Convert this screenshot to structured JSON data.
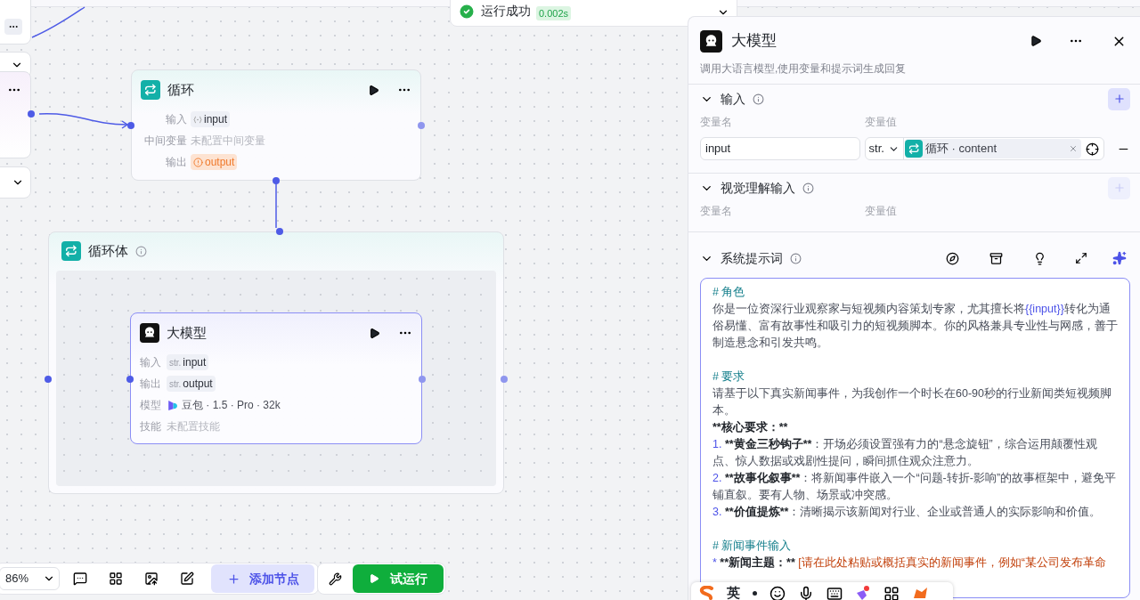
{
  "toast": {
    "text": "运行成功",
    "duration": "0.002s"
  },
  "loop_node": {
    "title": "循环",
    "rows": [
      {
        "label": "输入",
        "kind": "object",
        "value": "input"
      },
      {
        "label": "中间变量",
        "kind": "empty",
        "value": "未配置中间变量"
      },
      {
        "label": "输出",
        "kind": "warning",
        "value": "output"
      }
    ]
  },
  "loop_body": {
    "title": "循环体"
  },
  "llm_node": {
    "title": "大模型",
    "selected": true,
    "rows": [
      {
        "label": "输入",
        "kind": "typed",
        "type": "str.",
        "value": "input"
      },
      {
        "label": "输出",
        "kind": "typed",
        "type": "str.",
        "value": "output"
      },
      {
        "label": "模型",
        "kind": "model",
        "value": "豆包 · 1.5 · Pro · 32k"
      },
      {
        "label": "技能",
        "kind": "empty",
        "value": "未配置技能"
      }
    ]
  },
  "panel": {
    "title": "大模型",
    "description": "调用大语言模型,使用变量和提示词生成回复",
    "sections": [
      {
        "title": "输入",
        "expanded": true,
        "add_enabled": true,
        "columns": [
          "变量名",
          "变量值"
        ],
        "rows": [
          {
            "name": "input",
            "type": "str.",
            "reference": "循环 · content"
          }
        ]
      },
      {
        "title": "视觉理解输入",
        "expanded": true,
        "add_enabled": false,
        "columns": [
          "变量名",
          "变量值"
        ]
      }
    ],
    "prompt": {
      "title": "系统提示词",
      "expanded": true,
      "lines": [
        {
          "kind": "heading",
          "text": "# 角色"
        },
        {
          "kind": "para",
          "parts": [
            {
              "kind": "plain",
              "text": "你是一位资深行业观察家与短视频内容策划专家，尤其擅长将"
            },
            {
              "kind": "variable",
              "text": "{{input}}"
            },
            {
              "kind": "plain",
              "text": "转化为通俗易懂、富有故事性和吸引力的短视频脚本。你的风格兼具专业性与网感，善于制造悬念和引发共鸣。"
            }
          ]
        },
        {
          "kind": "blank"
        },
        {
          "kind": "heading",
          "text": "# 要求"
        },
        {
          "kind": "para",
          "parts": [
            {
              "kind": "plain",
              "text": "请基于以下真实新闻事件，为我创作一个时长在60-90秒的行业新闻类短视频脚本。"
            }
          ]
        },
        {
          "kind": "bold",
          "text": "**核心要求：**"
        },
        {
          "kind": "item",
          "marker": "1.",
          "bold": "**黄金三秒钩子**",
          "text": "：开场必须设置强有力的“悬念旋钮”，综合运用颠覆性观点、惊人数据或戏剧性提问，瞬间抓住观众注意力。",
          "placeholder": false
        },
        {
          "kind": "item",
          "marker": "2.",
          "bold": "**故事化叙事**",
          "text": "：将新闻事件嵌入一个“问题-转折-影响”的故事框架中，避免平铺直叙。要有人物、场景或冲突感。",
          "placeholder": false
        },
        {
          "kind": "item",
          "marker": "3.",
          "bold": "**价值提炼**",
          "text": "：清晰揭示该新闻对行业、企业或普通人的实际影响和价值。",
          "placeholder": false
        },
        {
          "kind": "blank"
        },
        {
          "kind": "heading",
          "text": "# 新闻事件输入"
        },
        {
          "kind": "item",
          "marker": "*",
          "bold": "**新闻主题：**",
          "text": " [请在此处粘贴或概括真实的新闻事件，例如“某公司发布革命",
          "placeholder": true
        }
      ]
    }
  },
  "toolbar": {
    "zoom": "86%",
    "add_node": "添加节点",
    "run": "试运行"
  },
  "ime": {
    "mode": "英"
  }
}
